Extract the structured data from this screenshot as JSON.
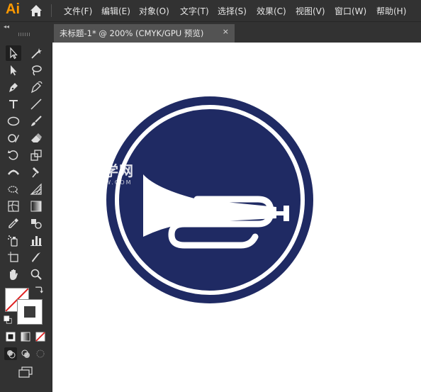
{
  "app": {
    "logo": "Ai"
  },
  "menu": [
    "文件(F)",
    "编辑(E)",
    "对象(O)",
    "文字(T)",
    "选择(S)",
    "效果(C)",
    "视图(V)",
    "窗口(W)",
    "帮助(H)"
  ],
  "panel": {
    "collapse_label": "◂◂"
  },
  "document_tab": {
    "title": "未标题-1* @ 200% (CMYK/GPU 预览)",
    "close": "×"
  },
  "watermark": {
    "text": "软件自学网",
    "sub": "WWW.RJZXW.COM"
  },
  "colors": {
    "fill": "#ffffff",
    "stroke": "#333333",
    "accent": "#ff9a00",
    "artwork": "#1f2a63",
    "slash": "#e02020"
  },
  "icons": [
    "home-icon",
    "selection-tool-icon",
    "magic-wand-icon",
    "direct-selection-icon",
    "lasso-icon",
    "pen-icon",
    "curvature-icon",
    "type-icon",
    "line-icon",
    "ellipse-icon",
    "paintbrush-icon",
    "shaper-icon",
    "eraser-icon",
    "rotate-icon",
    "scale-icon",
    "width-icon",
    "puppet-warp-icon",
    "free-transform-icon",
    "perspective-grid-icon",
    "mesh-icon",
    "gradient-icon",
    "eyedropper-icon",
    "blend-icon",
    "symbol-sprayer-icon",
    "column-graph-icon",
    "artboard-icon",
    "slice-icon",
    "hand-icon",
    "zoom-icon",
    "swap-icon",
    "default-colors-icon",
    "fill-color-icon",
    "gradient-mode-icon",
    "none-mode-icon",
    "draw-normal-icon",
    "draw-behind-icon",
    "draw-inside-icon",
    "screen-mode-icon",
    "bugle-icon"
  ]
}
